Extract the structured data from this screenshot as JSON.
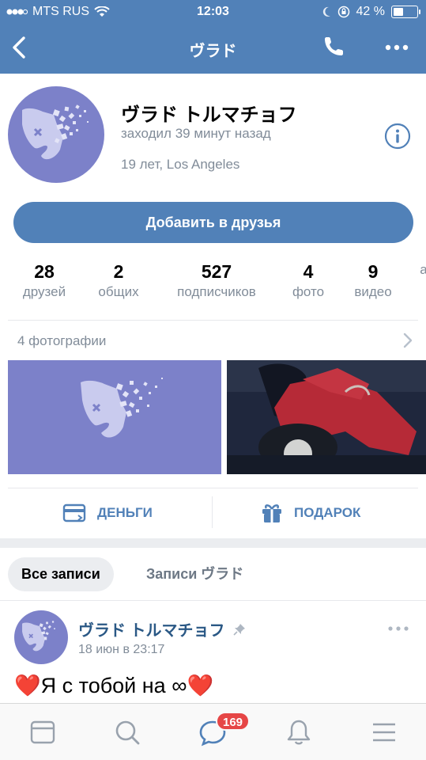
{
  "status_bar": {
    "carrier": "MTS RUS",
    "time": "12:03",
    "battery_percent": "42 %",
    "battery_level": 0.42
  },
  "nav": {
    "title": "ヴラド",
    "back_icon": "chevron-left-icon",
    "phone_icon": "phone-icon",
    "more_icon": "more-horizontal-icon"
  },
  "profile": {
    "name": "ヴラド トルマチョフ",
    "last_seen": "заходил 39 минут назад",
    "location": "19 лет, Los Angeles",
    "add_friend_label": "Добавить в друзья",
    "counters": [
      {
        "value": "28",
        "label": "друзей"
      },
      {
        "value": "2",
        "label": "общих"
      },
      {
        "value": "527",
        "label": "подписчиков"
      },
      {
        "value": "4",
        "label": "фото"
      },
      {
        "value": "9",
        "label": "видео"
      },
      {
        "value": "",
        "label": "а"
      }
    ]
  },
  "photos": {
    "header": "4 фотографии"
  },
  "actions": {
    "money_label": "ДЕНЬГИ",
    "gift_label": "ПОДАРОК"
  },
  "wall": {
    "tab_all": "Все записи",
    "tab_owner": "Записи ヴラド",
    "post": {
      "author": "ヴラド トルマチョフ",
      "date": "18 июн в 23:17",
      "text_left_heart": "❤️",
      "text": "Я с тобой на ∞",
      "text_right_heart": "❤️"
    }
  },
  "tabbar": {
    "messages_badge": "169"
  },
  "colors": {
    "brand": "#5181b8",
    "avatar_bg": "#7c81c9",
    "badge": "#e64646",
    "link": "#2a5885"
  }
}
